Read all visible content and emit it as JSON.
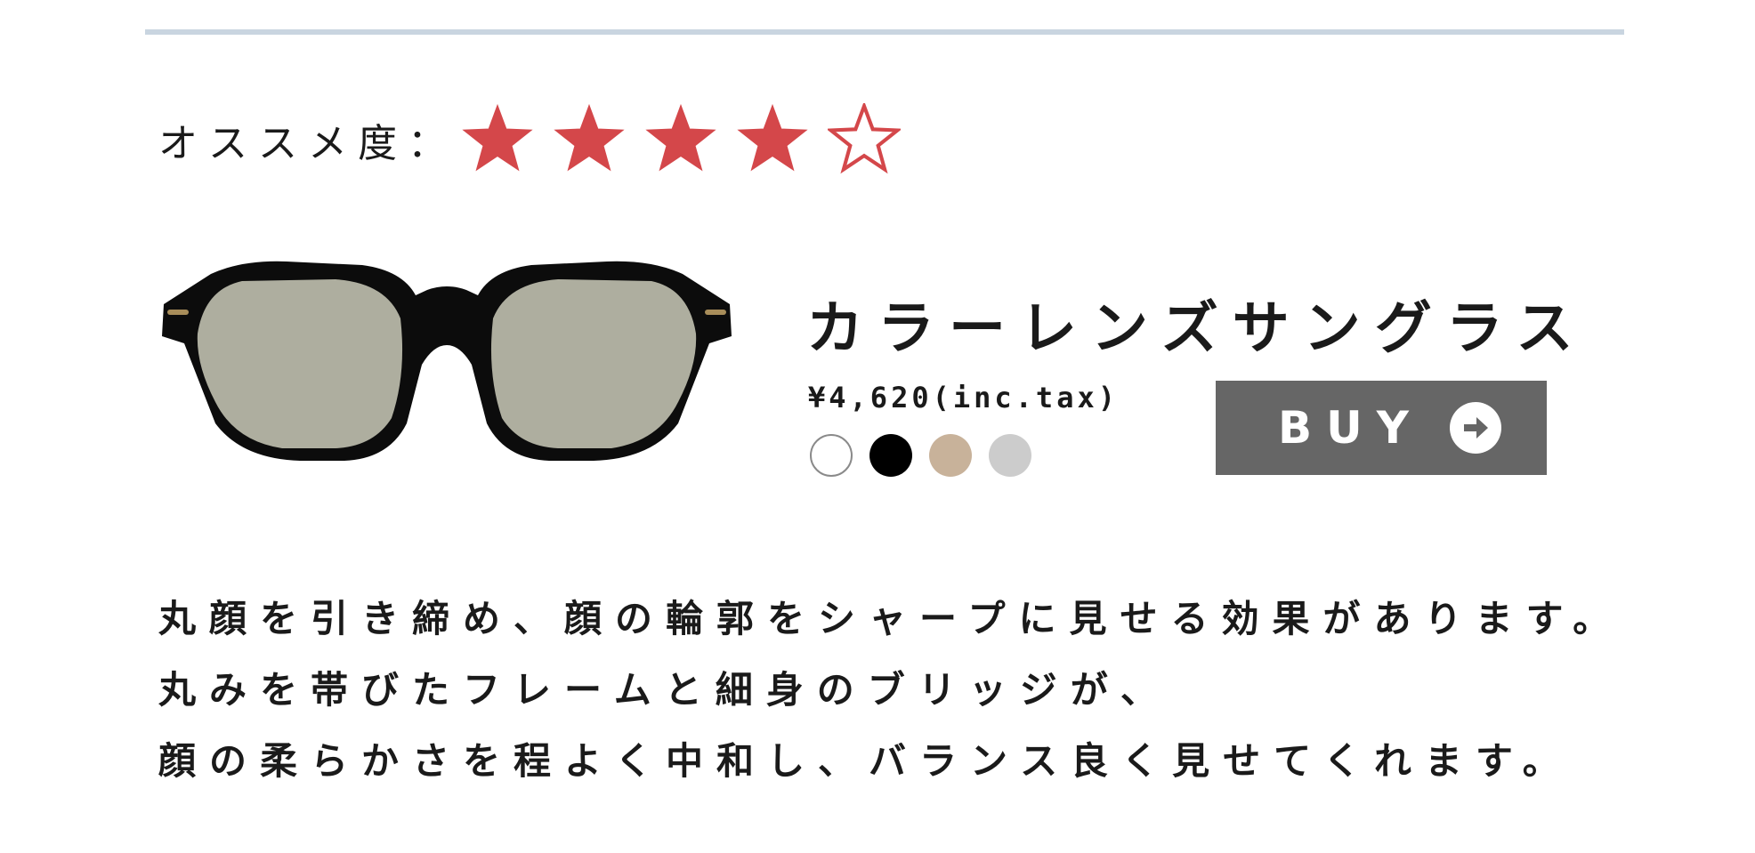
{
  "rating": {
    "label": "オススメ度：",
    "value": 4,
    "max": 5,
    "star_color": "#d4474a"
  },
  "product": {
    "name": "カラーレンズサングラス",
    "price": "¥4,620(inc.tax)",
    "color_options": [
      "#ffffff",
      "#000000",
      "#c8b29a",
      "#cccccc"
    ],
    "frame_color": "#0c0c0c",
    "lens_color": "#aeae9f"
  },
  "buy_button": {
    "label": "BUY",
    "icon": "arrow-right-circle-icon",
    "color": "#666666"
  },
  "description": {
    "lines": [
      "丸顔を引き締め、顔の輪郭をシャープに見せる効果があります。",
      "丸みを帯びたフレームと細身のブリッジが、",
      "顔の柔らかさを程よく中和し、バランス良く見せてくれます。"
    ]
  }
}
